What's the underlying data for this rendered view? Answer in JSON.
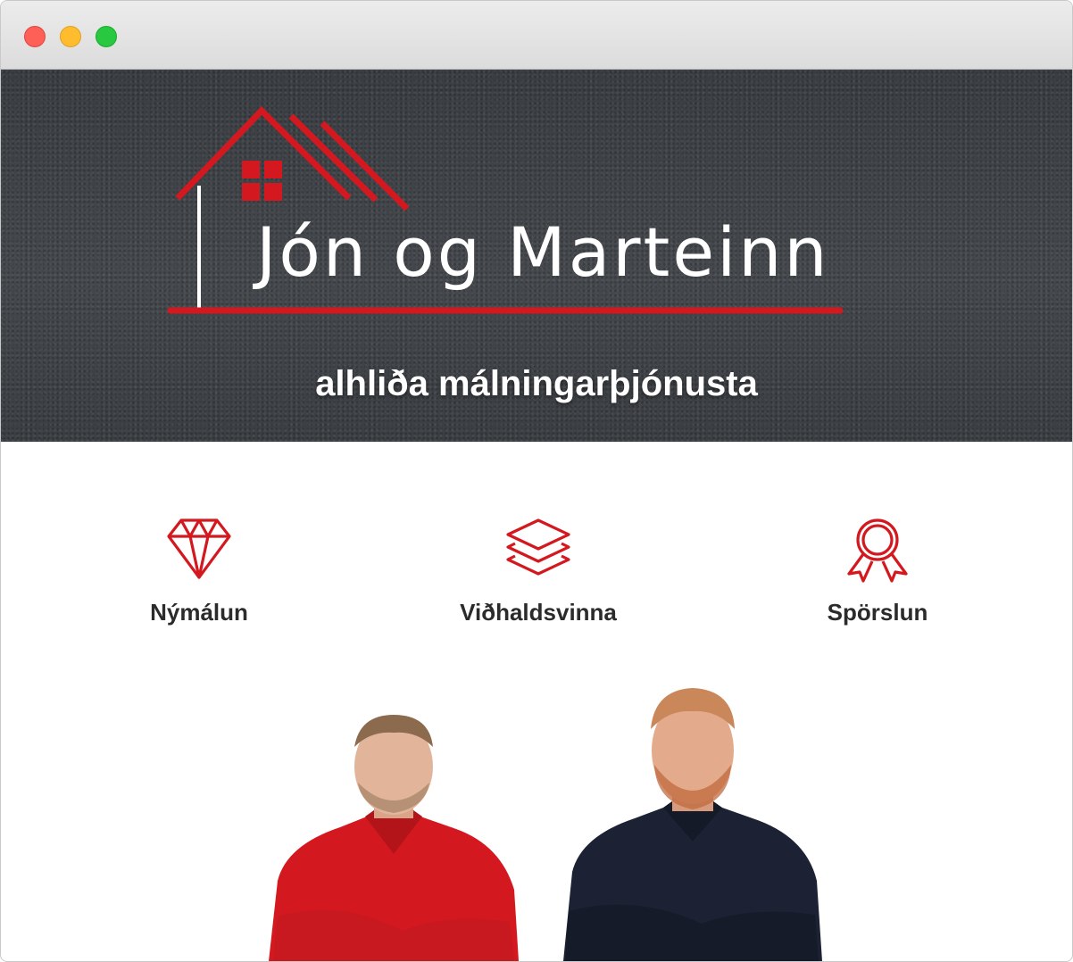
{
  "window": {
    "controls": [
      "close",
      "minimize",
      "zoom"
    ]
  },
  "hero": {
    "brand_name": "Jón og Marteinn",
    "tagline": "alhliða málningarþjónusta",
    "logo_icon": "house-logo-icon"
  },
  "features": [
    {
      "icon": "diamond-icon",
      "label": "Nýmálun"
    },
    {
      "icon": "layers-icon",
      "label": "Viðhaldsvinna"
    },
    {
      "icon": "award-ribbon-icon",
      "label": "Spörslun"
    }
  ],
  "team": [
    {
      "name_visible": false,
      "shirt_color": "#d3191f"
    },
    {
      "name_visible": false,
      "shirt_color": "#1c2233"
    }
  ],
  "colors": {
    "accent_red": "#d3191f",
    "hero_bg": "#3f4347",
    "text_dark": "#2b2b2b"
  }
}
